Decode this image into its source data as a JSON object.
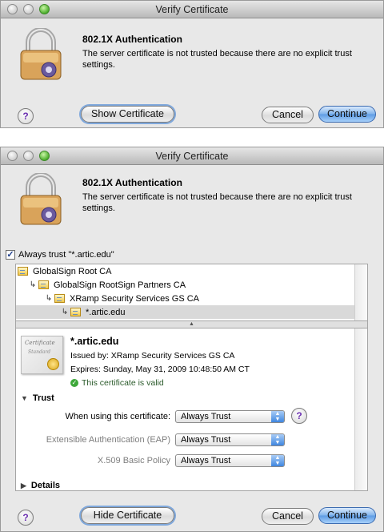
{
  "dialog_top": {
    "window_title": "Verify Certificate",
    "heading": "802.1X Authentication",
    "message": "The server certificate is not trusted because there are no explicit trust settings.",
    "help_label": "?",
    "show_certificate_label": "Show Certificate",
    "cancel_label": "Cancel",
    "continue_label": "Continue"
  },
  "dialog_bottom": {
    "window_title": "Verify Certificate",
    "heading": "802.1X Authentication",
    "message": "The server certificate is not trusted because there are no explicit trust settings.",
    "always_trust": {
      "checked": true,
      "label": "Always trust \"*.artic.edu\""
    },
    "chain": [
      {
        "label": "GlobalSign Root CA",
        "selected": false
      },
      {
        "label": "GlobalSign RootSign Partners CA",
        "selected": false
      },
      {
        "label": "XRamp Security Services GS CA",
        "selected": false
      },
      {
        "label": "*.artic.edu",
        "selected": true
      }
    ],
    "certificate": {
      "icon_text_1": "Certificate",
      "icon_text_2": "Standard",
      "name": "*.artic.edu",
      "issued_by": "Issued by: XRamp Security Services GS CA",
      "expires": "Expires: Sunday, May 31, 2009 10:48:50 AM CT",
      "status": "This certificate is valid"
    },
    "trust_section": {
      "label": "Trust",
      "when_using_label": "When using this certificate:",
      "when_using_value": "Always Trust",
      "eap_label": "Extensible Authentication (EAP)",
      "eap_value": "Always Trust",
      "x509_label": "X.509 Basic Policy",
      "x509_value": "Always Trust"
    },
    "details_label": "Details",
    "help_label": "?",
    "hide_certificate_label": "Hide Certificate",
    "cancel_label": "Cancel",
    "continue_label": "Continue"
  },
  "colors": {
    "default_button": "#5d9be4",
    "valid_green": "#3ea83a",
    "selection": "#d9d9d9"
  }
}
